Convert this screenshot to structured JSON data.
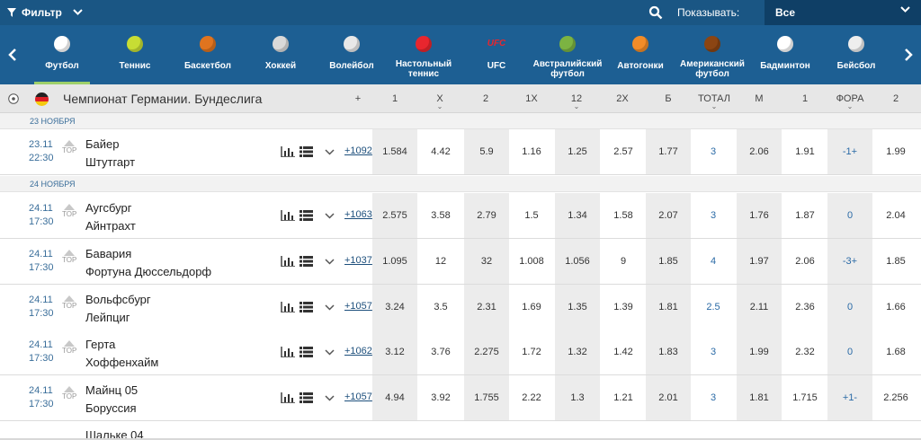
{
  "filter": {
    "label": "Фильтр"
  },
  "show": {
    "label": "Показывать:",
    "value": "Все"
  },
  "sports": [
    {
      "label": "Футбол",
      "icon": "soccer-ball-icon",
      "color": "#ffffff",
      "active": true
    },
    {
      "label": "Теннис",
      "icon": "tennis-ball-icon",
      "color": "#c7dd34"
    },
    {
      "label": "Баскетбол",
      "icon": "basketball-icon",
      "color": "#e0741f"
    },
    {
      "label": "Хоккей",
      "icon": "hockey-skate-icon",
      "color": "#d9d9d9"
    },
    {
      "label": "Волейбол",
      "icon": "volleyball-icon",
      "color": "#e8e8e8"
    },
    {
      "label": "Настольный теннис",
      "icon": "ping-pong-icon",
      "color": "#e8262e"
    },
    {
      "label": "UFC",
      "icon": "ufc-logo-icon",
      "color": "#e8262e",
      "badge": "UFC"
    },
    {
      "label": "Австралийский футбол",
      "icon": "aussie-football-icon",
      "color": "#7cb342"
    },
    {
      "label": "Автогонки",
      "icon": "racing-helmet-icon",
      "color": "#f28c28"
    },
    {
      "label": "Американский футбол",
      "icon": "american-football-icon",
      "color": "#8b4513"
    },
    {
      "label": "Бадминтон",
      "icon": "shuttlecock-icon",
      "color": "#ffffff"
    },
    {
      "label": "Бейсбол",
      "icon": "baseball-icon",
      "color": "#eeeeee"
    }
  ],
  "league": {
    "title": "Чемпионат Германии. Бундеслига",
    "columns": [
      "+",
      "1",
      "X",
      "2",
      "1X",
      "12",
      "2X",
      "Б",
      "ТОТАЛ",
      "М",
      "1",
      "ФОРА",
      "2"
    ]
  },
  "dates": [
    "23 НОЯБРЯ",
    "24 НОЯБРЯ"
  ],
  "matches": [
    {
      "date": "23.11",
      "time": "22:30",
      "top": "TOP",
      "team1": "Байер",
      "team2": "Штутгарт",
      "more": "+1092",
      "odds": [
        "1.584",
        "4.42",
        "5.9",
        "1.16",
        "1.25",
        "2.57",
        "1.77",
        "3",
        "2.06",
        "1.91",
        "-1+",
        "1.99"
      ]
    },
    {
      "date": "24.11",
      "time": "17:30",
      "top": "TOP",
      "team1": "Аугсбург",
      "team2": "Айнтрахт",
      "more": "+1063",
      "odds": [
        "2.575",
        "3.58",
        "2.79",
        "1.5",
        "1.34",
        "1.58",
        "2.07",
        "3",
        "1.76",
        "1.87",
        "0",
        "2.04"
      ]
    },
    {
      "date": "24.11",
      "time": "17:30",
      "top": "TOP",
      "team1": "Бавария",
      "team2": "Фортуна Дюссельдорф",
      "more": "+1037",
      "odds": [
        "1.095",
        "12",
        "32",
        "1.008",
        "1.056",
        "9",
        "1.85",
        "4",
        "1.97",
        "2.06",
        "-3+",
        "1.85"
      ]
    },
    {
      "date": "24.11",
      "time": "17:30",
      "top": "TOP",
      "team1": "Вольфсбург",
      "team2": "Лейпциг",
      "more": "+1057",
      "odds": [
        "3.24",
        "3.5",
        "2.31",
        "1.69",
        "1.35",
        "1.39",
        "1.81",
        "2.5",
        "2.11",
        "2.36",
        "0",
        "1.66"
      ]
    },
    {
      "date": "24.11",
      "time": "17:30",
      "top": "TOP",
      "team1": "Герта",
      "team2": "Хоффенхайм",
      "more": "+1062",
      "odds": [
        "3.12",
        "3.76",
        "2.275",
        "1.72",
        "1.32",
        "1.42",
        "1.83",
        "3",
        "1.99",
        "2.32",
        "0",
        "1.68"
      ]
    },
    {
      "date": "24.11",
      "time": "17:30",
      "top": "TOP",
      "team1": "Майнц 05",
      "team2": "Боруссия",
      "more": "+1057",
      "odds": [
        "4.94",
        "3.92",
        "1.755",
        "2.22",
        "1.3",
        "1.21",
        "2.01",
        "3",
        "1.81",
        "1.715",
        "+1-",
        "2.256"
      ]
    }
  ],
  "partial_team": "Шальке 04"
}
